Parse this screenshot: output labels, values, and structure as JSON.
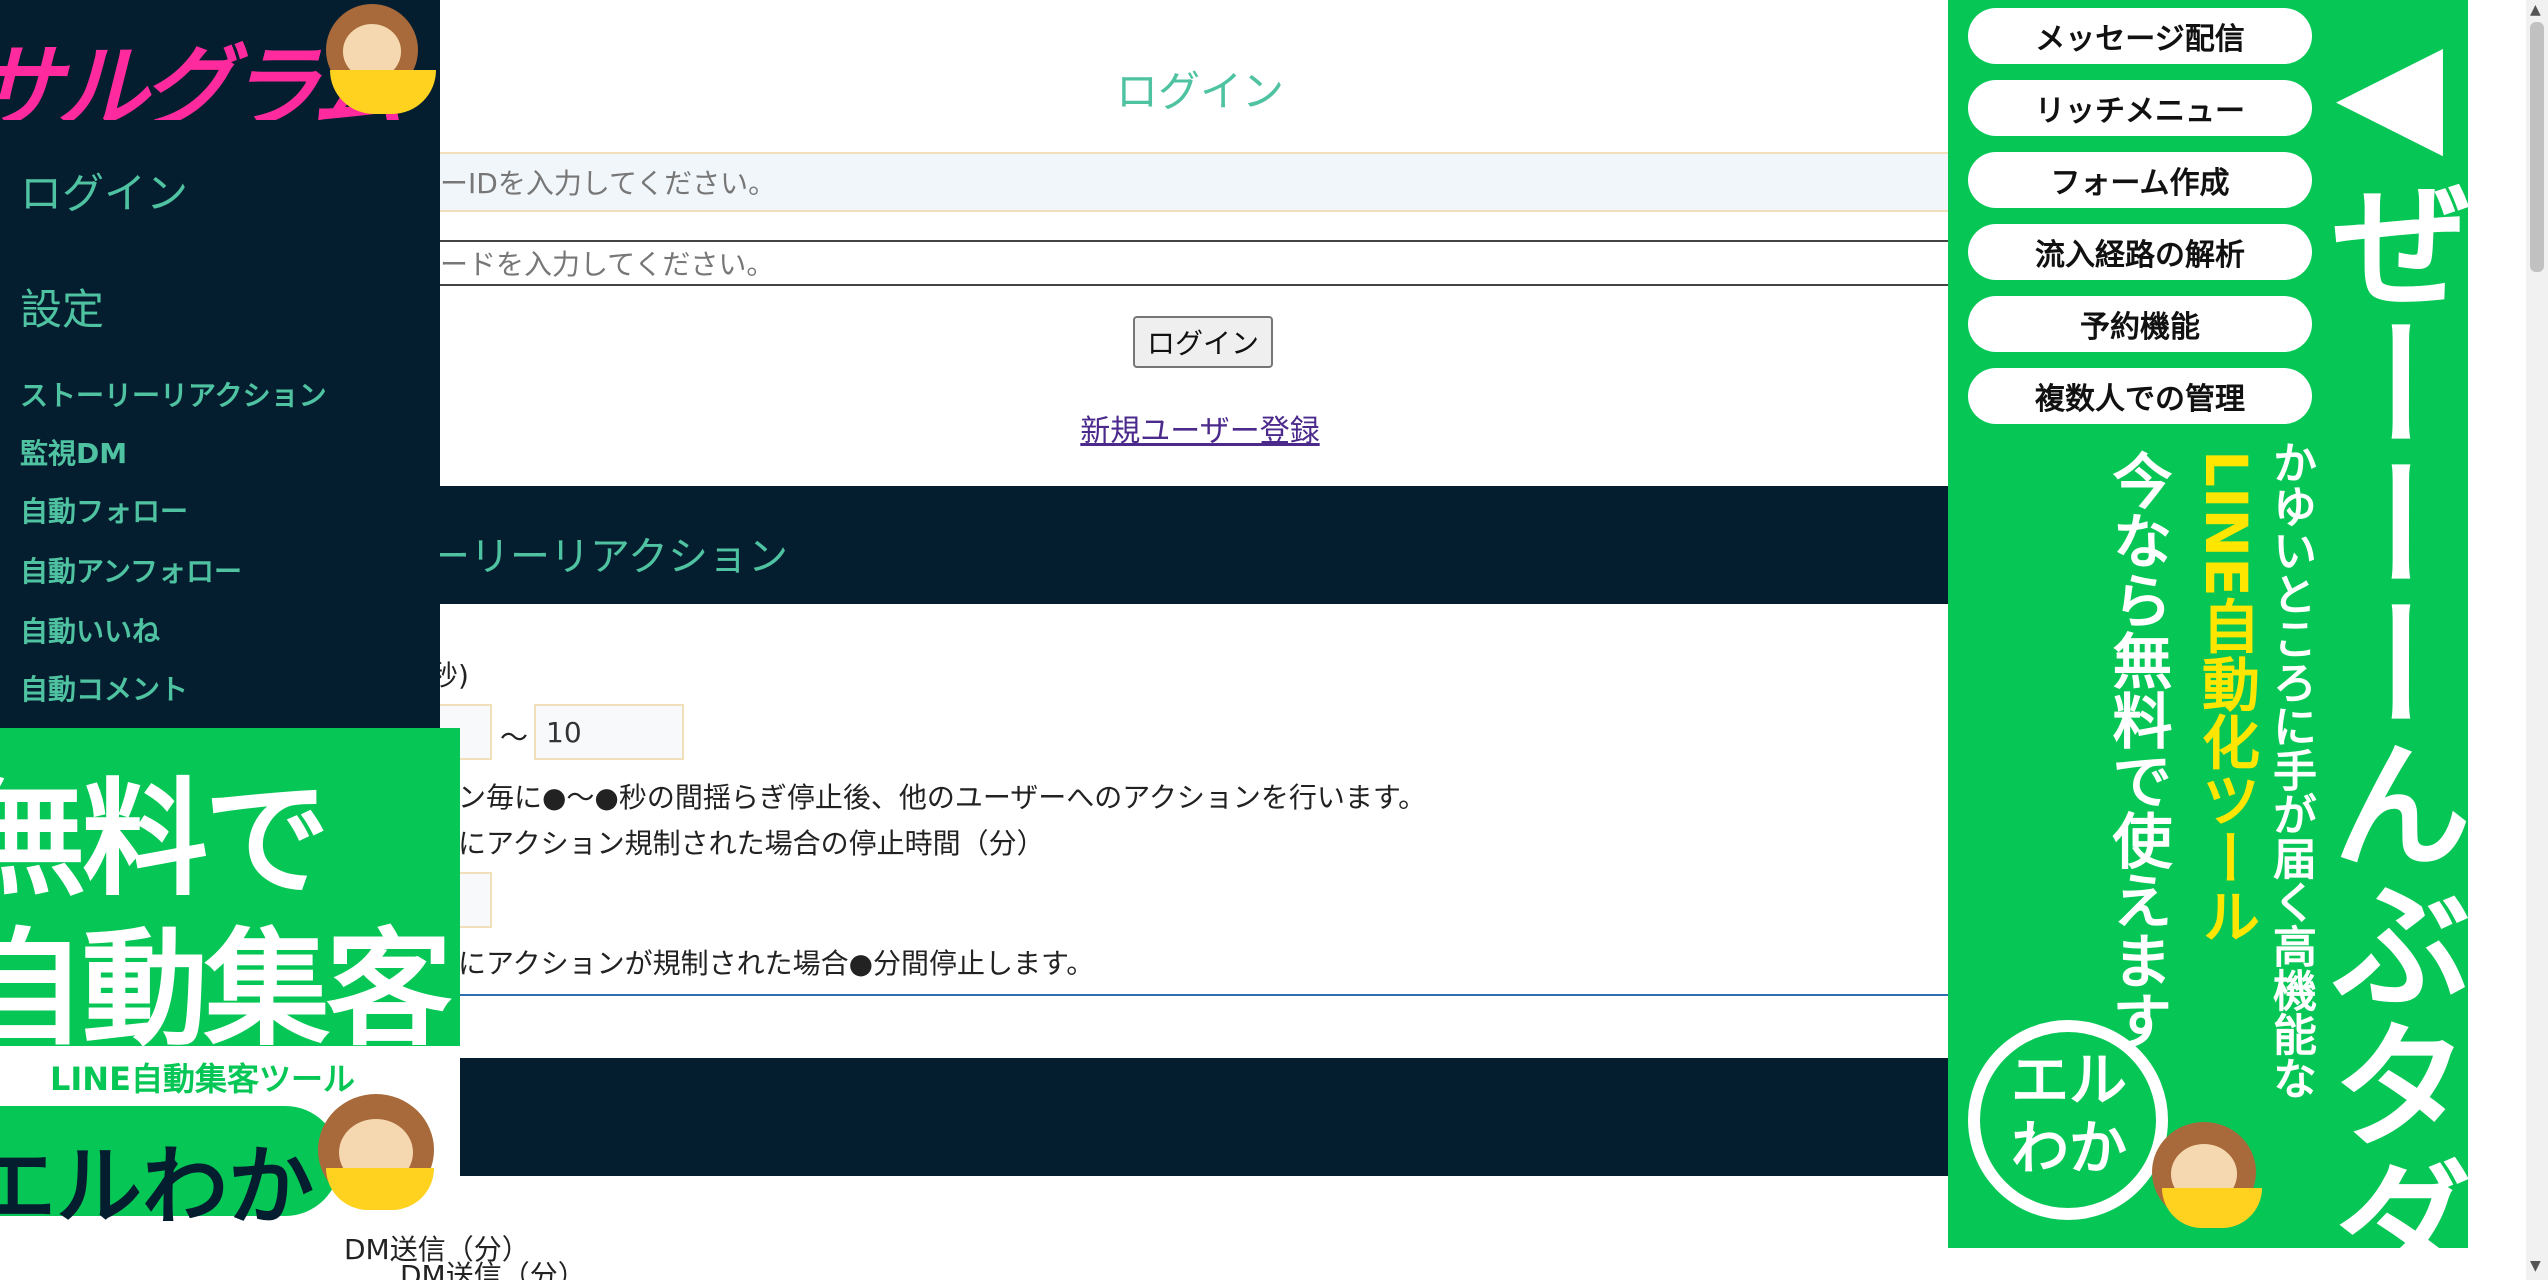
{
  "login": {
    "title": "ログイン",
    "user_placeholder": "ーIDを入力してください。",
    "pass_placeholder": "ードを入力してください。",
    "button": "ログイン",
    "register_link": "新規ユーザー登録"
  },
  "section": {
    "title": "ーリーリアクション",
    "label_seconds": "秒)",
    "interval_to": "10",
    "tilde": "～",
    "desc_interval": "ョン毎に●～●秒の間揺らぎ停止後、他のユーザーへのアクションを行います。",
    "label_stop": "側にアクション規制された場合の停止時間（分）",
    "desc_stop": "側にアクションが規制された場合●分間停止します。"
  },
  "footer_labels": [
    "DM送信（分）",
    "DM送信（分）"
  ],
  "sidebar": {
    "logo": "サルグラム",
    "items_main": [
      "ログイン",
      "設定"
    ],
    "items_sub": [
      "ストーリーリアクション",
      "監視DM",
      "自動フォロー",
      "自動アンフォロー",
      "自動いいね",
      "自動コメント"
    ]
  },
  "ad_left": {
    "line1": "無料で",
    "line2": "自動集客",
    "sub": "LINE自動集客ツール",
    "brand": "エルわか"
  },
  "ad_right": {
    "chips": [
      "メッセージ配信",
      "リッチメニュー",
      "フォーム作成",
      "流入経路の解析",
      "予約機能",
      "複数人での管理"
    ],
    "headline": "◀ぜーーーんぶタダ",
    "col1": "かゆいところに手が届く高機能な",
    "col2": "LINE自動化ツール",
    "col3": "今なら無料で使えます",
    "badge": "エルわか"
  },
  "colors": {
    "teal": "#4fc3a1",
    "navy": "#041e30",
    "line_green": "#06c755",
    "yellow": "#ffe600"
  },
  "icons": [
    "monkey-mascot-icon",
    "banana-icon",
    "scroll-up-arrow-icon",
    "scroll-down-arrow-icon"
  ]
}
